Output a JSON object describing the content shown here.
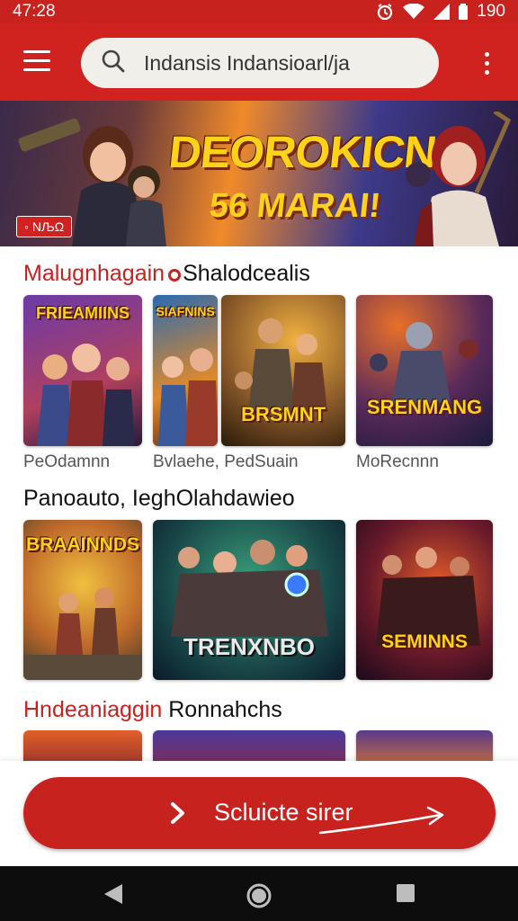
{
  "status": {
    "time": "47:28",
    "battery": "190",
    "icons": [
      "alarm-icon",
      "wifi-icon",
      "signal-icon",
      "battery-icon"
    ]
  },
  "header": {
    "search_value": "Indansis Indansioarl/ja",
    "icons": [
      "menu-icon",
      "search-icon",
      "more-vert-icon"
    ]
  },
  "banner": {
    "title": "DEOROKICN",
    "subtitle": "56 MARAI!",
    "badge": "◦ ΝЉΩ"
  },
  "sections": [
    {
      "title_prefix": "Malugnhagain",
      "title_suffix": "Shalodcealis",
      "tiles": [
        {
          "label": "FRIEAMIINS"
        },
        {
          "label": "SIAFNINS"
        },
        {
          "label": "BRSMNT"
        },
        {
          "label": "SRENMANG"
        }
      ],
      "captions": [
        "PeOdamnn",
        "Bvlaehe, PedSuain",
        "MoRecnnn"
      ]
    },
    {
      "title": "Panoauto, IeghOlahdawieo",
      "tiles": [
        {
          "label": "BRAAINNDS"
        },
        {
          "label": "TRENXNBO"
        },
        {
          "label": "SEMINNS"
        }
      ]
    },
    {
      "title_prefix": "Hndeaniaggin",
      "title_suffix": "Ronnahchs"
    }
  ],
  "cta": {
    "label": "Scluicte sirer"
  },
  "colors": {
    "brand_red": "#d0231f",
    "title_yellow": "#ffd21a",
    "background": "#ffffff"
  }
}
